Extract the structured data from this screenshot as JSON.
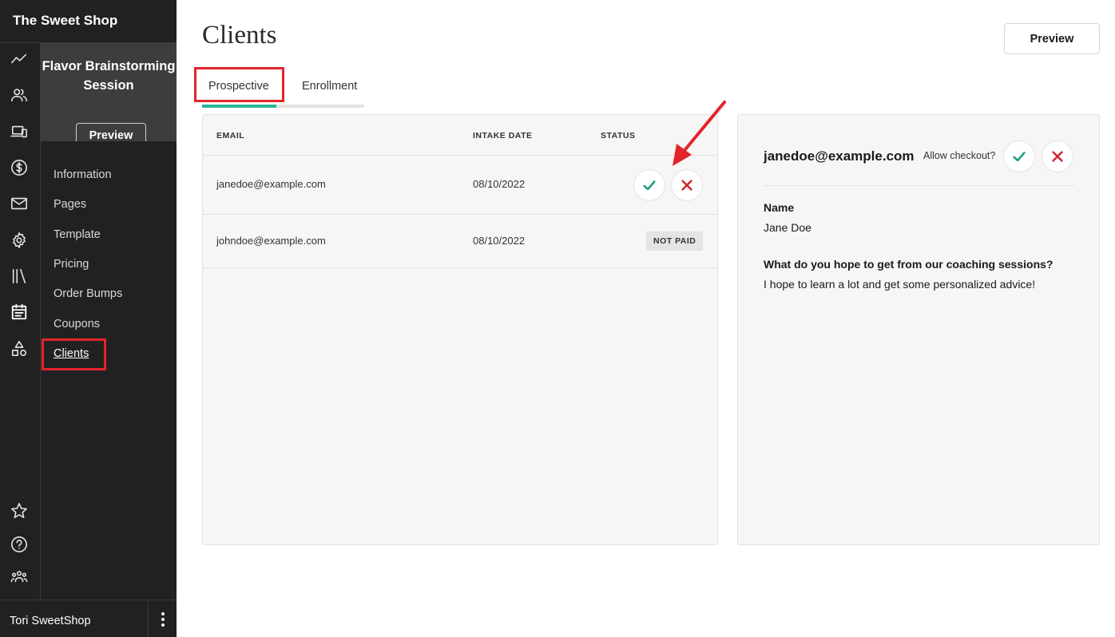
{
  "app": {
    "shop_name": "The Sweet Shop"
  },
  "product": {
    "title": "Flavor Brainstorming Session",
    "preview_label": "Preview"
  },
  "nav": {
    "items": [
      {
        "label": "Information"
      },
      {
        "label": "Pages"
      },
      {
        "label": "Template"
      },
      {
        "label": "Pricing"
      },
      {
        "label": "Order Bumps"
      },
      {
        "label": "Coupons"
      },
      {
        "label": "Clients",
        "active": true
      }
    ]
  },
  "rail_icons": [
    "analytics-icon",
    "customers-icon",
    "devices-icon",
    "dollar-icon",
    "mail-icon",
    "settings-icon",
    "library-icon",
    "calendar-icon",
    "shapes-icon",
    "star-icon",
    "help-icon",
    "community-icon"
  ],
  "footer": {
    "user_name": "Tori SweetShop",
    "menu_icon": "more-vertical-icon"
  },
  "page": {
    "title": "Clients",
    "preview_label": "Preview"
  },
  "tabs": [
    {
      "label": "Prospective",
      "active": true
    },
    {
      "label": "Enrollment",
      "active": false
    }
  ],
  "table": {
    "headers": {
      "email": "EMAIL",
      "intake_date": "INTAKE DATE",
      "status": "STATUS"
    },
    "rows": [
      {
        "email": "janedoe@example.com",
        "intake_date": "08/10/2022",
        "status": "actions"
      },
      {
        "email": "johndoe@example.com",
        "intake_date": "08/10/2022",
        "status": "NOT PAID"
      }
    ]
  },
  "detail": {
    "email": "janedoe@example.com",
    "allow_checkout_label": "Allow checkout?",
    "fields": [
      {
        "label": "Name",
        "value": "Jane Doe"
      },
      {
        "label": "What do you hope to get from our coaching sessions?",
        "value": "I hope to learn a lot and get some personalized advice!"
      }
    ]
  },
  "colors": {
    "accent": "#2ab39a",
    "approve": "#1f9b82",
    "reject": "#d0262e",
    "annotation": "#e3242b",
    "sidebar_bg": "#212121"
  }
}
